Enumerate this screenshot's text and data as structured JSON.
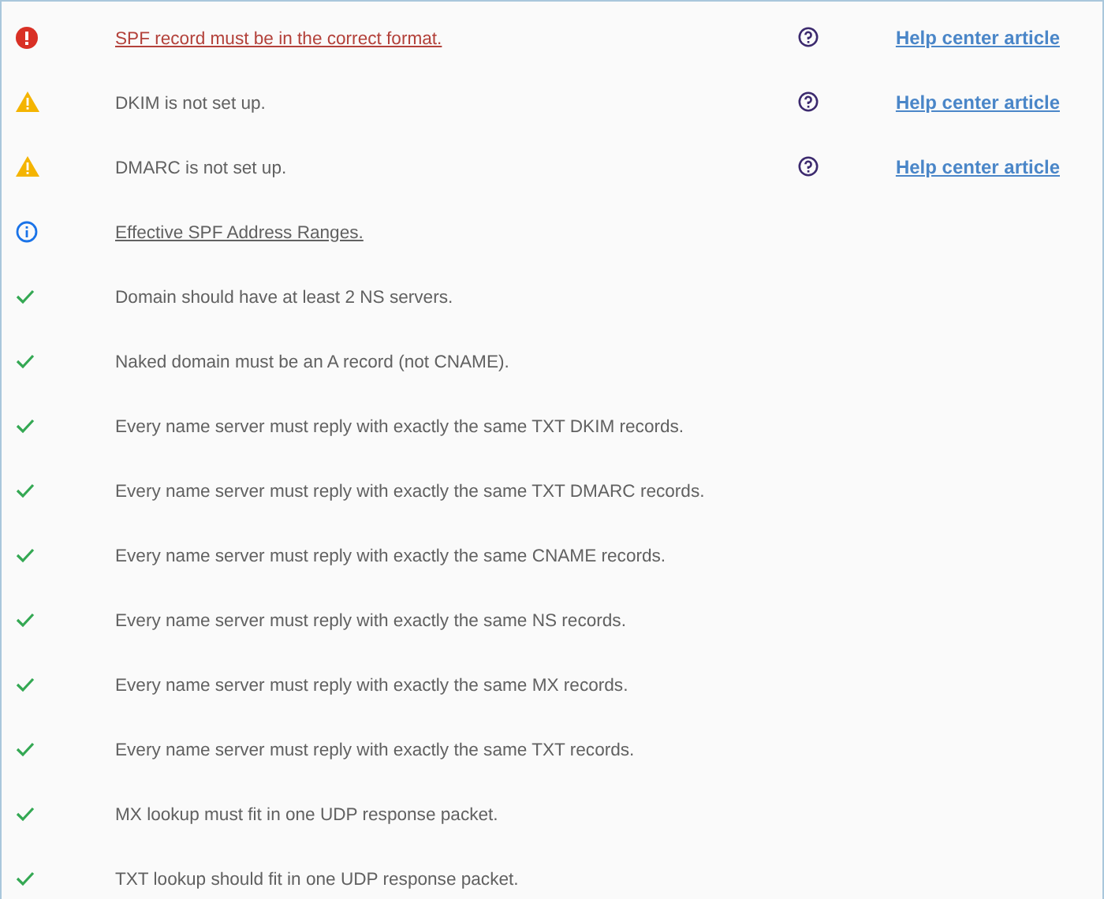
{
  "checks": [
    {
      "kind": "error",
      "text": "SPF record must be in the correct format.",
      "linked": true,
      "help": "Help center article"
    },
    {
      "kind": "warning",
      "text": "DKIM is not set up.",
      "linked": false,
      "help": "Help center article"
    },
    {
      "kind": "warning",
      "text": "DMARC is not set up.",
      "linked": false,
      "help": "Help center article"
    },
    {
      "kind": "info",
      "text": "Effective SPF Address Ranges.",
      "linked": true
    },
    {
      "kind": "ok",
      "text": "Domain should have at least 2 NS servers.",
      "linked": false
    },
    {
      "kind": "ok",
      "text": "Naked domain must be an A record (not CNAME).",
      "linked": false
    },
    {
      "kind": "ok",
      "text": "Every name server must reply with exactly the same TXT DKIM records.",
      "linked": false
    },
    {
      "kind": "ok",
      "text": "Every name server must reply with exactly the same TXT DMARC records.",
      "linked": false
    },
    {
      "kind": "ok",
      "text": "Every name server must reply with exactly the same CNAME records.",
      "linked": false
    },
    {
      "kind": "ok",
      "text": "Every name server must reply with exactly the same NS records.",
      "linked": false
    },
    {
      "kind": "ok",
      "text": "Every name server must reply with exactly the same MX records.",
      "linked": false
    },
    {
      "kind": "ok",
      "text": "Every name server must reply with exactly the same TXT records.",
      "linked": false
    },
    {
      "kind": "ok",
      "text": "MX lookup must fit in one UDP response packet.",
      "linked": false
    },
    {
      "kind": "ok",
      "text": "TXT lookup should fit in one UDP response packet.",
      "linked": false
    }
  ]
}
